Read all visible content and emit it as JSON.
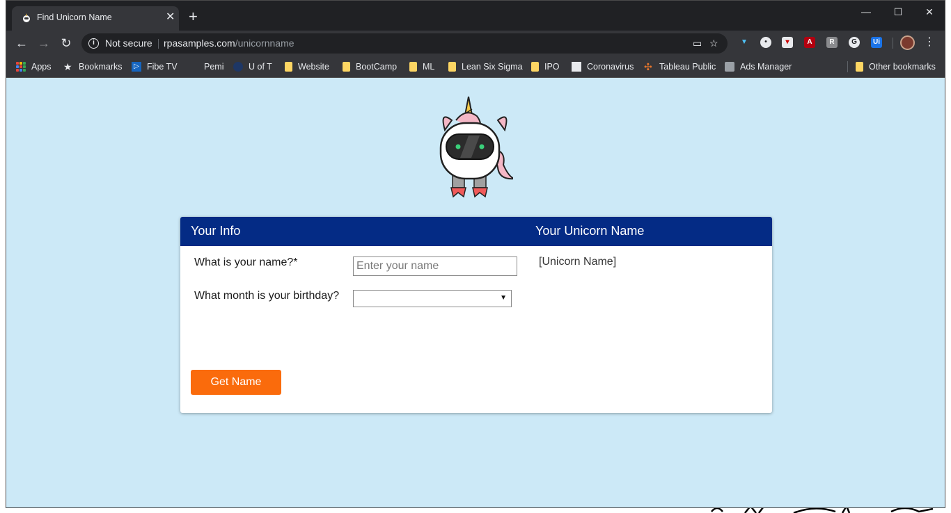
{
  "browser": {
    "tab_title": "Find Unicorn Name",
    "tab_close": "✕",
    "new_tab": "+",
    "window_controls": {
      "minimize": "—",
      "maximize": "☐",
      "close": "✕"
    },
    "nav": {
      "back": "←",
      "forward": "→",
      "reload": "↻"
    },
    "security_text": "Not secure",
    "url_host": "rpasamples.com",
    "url_path": "/unicornname",
    "menu": "⋮"
  },
  "bookmarks": {
    "apps": "Apps",
    "bookmarks": "Bookmarks",
    "fibe_tv": "Fibe TV",
    "pemi": "Pemi",
    "uoft": "U of T",
    "website": "Website",
    "bootcamp": "BootCamp",
    "ml": "ML",
    "lean": "Lean Six Sigma",
    "ipo": "IPO",
    "coronavirus": "Coronavirus",
    "tableau": "Tableau Public",
    "ads": "Ads Manager",
    "other": "Other bookmarks"
  },
  "form": {
    "header_left": "Your Info",
    "header_right": "Your Unicorn Name",
    "name_label": "What is your name?*",
    "name_placeholder": "Enter your name",
    "name_value": "",
    "month_label": "What month is your birthday?",
    "month_value": "",
    "result": "[Unicorn Name]",
    "submit_label": "Get Name"
  },
  "colors": {
    "page_bg": "#cce9f7",
    "header_bg": "#042b85",
    "button_bg": "#fa6b0c",
    "browser_dark": "#202124"
  }
}
